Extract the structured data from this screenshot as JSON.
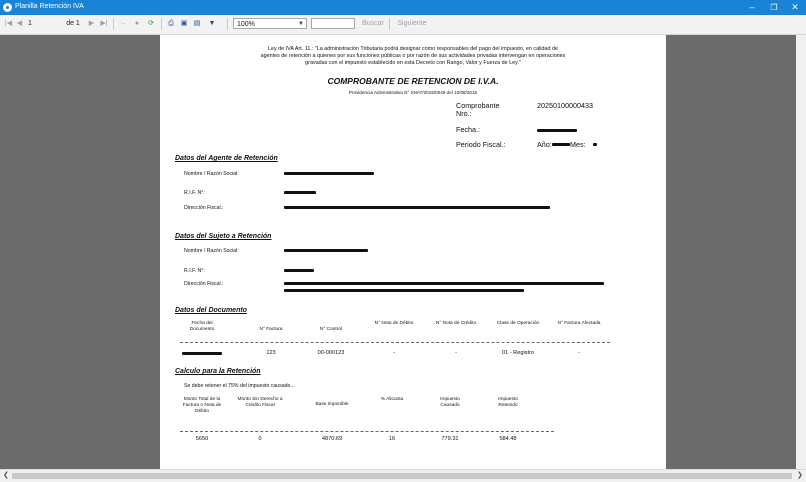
{
  "window": {
    "title": "Planilla Retención IVA"
  },
  "toolbar": {
    "page_current": "1",
    "page_of": "de 1",
    "zoom": "100%",
    "search_placeholder": "",
    "find_label": "Buscar",
    "next_label": "Siguiente"
  },
  "report": {
    "law_text_1": "Ley de IVA Art. 11.: \"La administración Tributaria podrá designar como responsables del pago del impuesto, en calidad de",
    "law_text_2": "agentes de retención a quienes por sus funciones públicas o por razón de sus actividades privadas intervengan en operaciones",
    "law_text_3": "gravadas con el impuesto establecido en esta Decreto con Rango, Valor y Fuerza de Ley.\"",
    "title": "COMPROBANTE DE RETENCION DE I.V.A.",
    "providencia": "Providencia Administrativa N° SNAT/2015/0049 del 10/08/2015",
    "comprobante_label": "Comprobante",
    "comprobante_label_2": "Nro.:",
    "comprobante_value": "20250100000433",
    "fecha_label": "Fecha.:",
    "periodo_label": "Periodo Fiscal.:",
    "periodo_year_label": "Año:",
    "periodo_month_label": "Mes:",
    "agente": {
      "heading": "Datos del Agente de Retención",
      "name_label": "Nombre / Razón Social:",
      "rif_label": "R.I.F. N°:",
      "address_label": "Dirección Fiscal.:"
    },
    "sujeto": {
      "heading": "Datos del Sujeto a Retención",
      "name_label": "Nombre / Razón Social:",
      "rif_label": "R.I.F. N°:",
      "address_label": "Dirección Fiscal.:"
    },
    "documento": {
      "heading": "Datos del Documento",
      "headers": [
        "Fecha del Documento",
        "N° Factura",
        "N° Control",
        "N° Nota de Débito",
        "N° Nota de Crédito",
        "Clase de Operación",
        "N° Factura Afectada"
      ],
      "row": [
        "",
        "123",
        "00-000123",
        "-",
        "-",
        "01 - Registro",
        "-"
      ]
    },
    "calculo": {
      "heading": "Calculo para la Retención",
      "note": "Se debe retener el 75% del impuesto causado...",
      "headers": [
        "Monto Total de la Factura o Nota de Débito",
        "Monto Sin Derecho a Crédito Fiscal",
        "Base Imponible",
        "% Alicuota",
        "Impuesto Causado",
        "Impuesto Retenido"
      ],
      "row": [
        "5650",
        "0",
        "4870.69",
        "16",
        "779.31",
        "584.48"
      ]
    }
  }
}
